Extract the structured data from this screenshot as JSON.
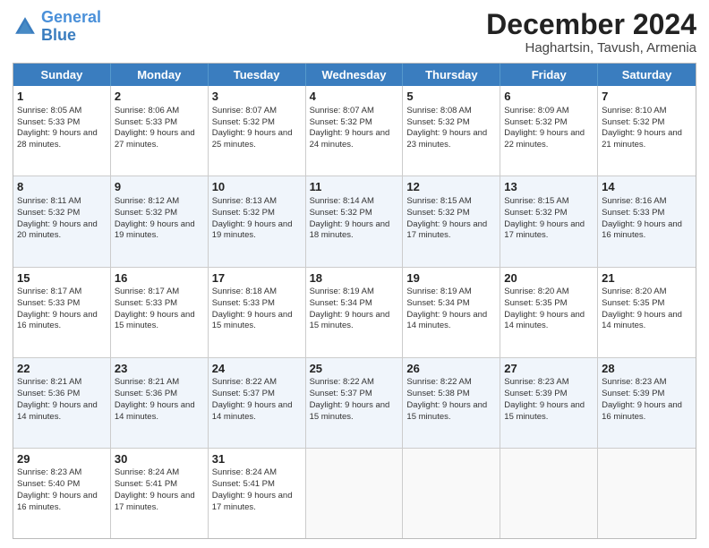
{
  "header": {
    "logo_line1": "General",
    "logo_line2": "Blue",
    "title": "December 2024",
    "subtitle": "Haghartsin, Tavush, Armenia"
  },
  "days": [
    "Sunday",
    "Monday",
    "Tuesday",
    "Wednesday",
    "Thursday",
    "Friday",
    "Saturday"
  ],
  "weeks": [
    [
      {
        "num": "1",
        "sunrise": "Sunrise: 8:05 AM",
        "sunset": "Sunset: 5:33 PM",
        "daylight": "Daylight: 9 hours and 28 minutes."
      },
      {
        "num": "2",
        "sunrise": "Sunrise: 8:06 AM",
        "sunset": "Sunset: 5:33 PM",
        "daylight": "Daylight: 9 hours and 27 minutes."
      },
      {
        "num": "3",
        "sunrise": "Sunrise: 8:07 AM",
        "sunset": "Sunset: 5:32 PM",
        "daylight": "Daylight: 9 hours and 25 minutes."
      },
      {
        "num": "4",
        "sunrise": "Sunrise: 8:07 AM",
        "sunset": "Sunset: 5:32 PM",
        "daylight": "Daylight: 9 hours and 24 minutes."
      },
      {
        "num": "5",
        "sunrise": "Sunrise: 8:08 AM",
        "sunset": "Sunset: 5:32 PM",
        "daylight": "Daylight: 9 hours and 23 minutes."
      },
      {
        "num": "6",
        "sunrise": "Sunrise: 8:09 AM",
        "sunset": "Sunset: 5:32 PM",
        "daylight": "Daylight: 9 hours and 22 minutes."
      },
      {
        "num": "7",
        "sunrise": "Sunrise: 8:10 AM",
        "sunset": "Sunset: 5:32 PM",
        "daylight": "Daylight: 9 hours and 21 minutes."
      }
    ],
    [
      {
        "num": "8",
        "sunrise": "Sunrise: 8:11 AM",
        "sunset": "Sunset: 5:32 PM",
        "daylight": "Daylight: 9 hours and 20 minutes."
      },
      {
        "num": "9",
        "sunrise": "Sunrise: 8:12 AM",
        "sunset": "Sunset: 5:32 PM",
        "daylight": "Daylight: 9 hours and 19 minutes."
      },
      {
        "num": "10",
        "sunrise": "Sunrise: 8:13 AM",
        "sunset": "Sunset: 5:32 PM",
        "daylight": "Daylight: 9 hours and 19 minutes."
      },
      {
        "num": "11",
        "sunrise": "Sunrise: 8:14 AM",
        "sunset": "Sunset: 5:32 PM",
        "daylight": "Daylight: 9 hours and 18 minutes."
      },
      {
        "num": "12",
        "sunrise": "Sunrise: 8:15 AM",
        "sunset": "Sunset: 5:32 PM",
        "daylight": "Daylight: 9 hours and 17 minutes."
      },
      {
        "num": "13",
        "sunrise": "Sunrise: 8:15 AM",
        "sunset": "Sunset: 5:32 PM",
        "daylight": "Daylight: 9 hours and 17 minutes."
      },
      {
        "num": "14",
        "sunrise": "Sunrise: 8:16 AM",
        "sunset": "Sunset: 5:33 PM",
        "daylight": "Daylight: 9 hours and 16 minutes."
      }
    ],
    [
      {
        "num": "15",
        "sunrise": "Sunrise: 8:17 AM",
        "sunset": "Sunset: 5:33 PM",
        "daylight": "Daylight: 9 hours and 16 minutes."
      },
      {
        "num": "16",
        "sunrise": "Sunrise: 8:17 AM",
        "sunset": "Sunset: 5:33 PM",
        "daylight": "Daylight: 9 hours and 15 minutes."
      },
      {
        "num": "17",
        "sunrise": "Sunrise: 8:18 AM",
        "sunset": "Sunset: 5:33 PM",
        "daylight": "Daylight: 9 hours and 15 minutes."
      },
      {
        "num": "18",
        "sunrise": "Sunrise: 8:19 AM",
        "sunset": "Sunset: 5:34 PM",
        "daylight": "Daylight: 9 hours and 15 minutes."
      },
      {
        "num": "19",
        "sunrise": "Sunrise: 8:19 AM",
        "sunset": "Sunset: 5:34 PM",
        "daylight": "Daylight: 9 hours and 14 minutes."
      },
      {
        "num": "20",
        "sunrise": "Sunrise: 8:20 AM",
        "sunset": "Sunset: 5:35 PM",
        "daylight": "Daylight: 9 hours and 14 minutes."
      },
      {
        "num": "21",
        "sunrise": "Sunrise: 8:20 AM",
        "sunset": "Sunset: 5:35 PM",
        "daylight": "Daylight: 9 hours and 14 minutes."
      }
    ],
    [
      {
        "num": "22",
        "sunrise": "Sunrise: 8:21 AM",
        "sunset": "Sunset: 5:36 PM",
        "daylight": "Daylight: 9 hours and 14 minutes."
      },
      {
        "num": "23",
        "sunrise": "Sunrise: 8:21 AM",
        "sunset": "Sunset: 5:36 PM",
        "daylight": "Daylight: 9 hours and 14 minutes."
      },
      {
        "num": "24",
        "sunrise": "Sunrise: 8:22 AM",
        "sunset": "Sunset: 5:37 PM",
        "daylight": "Daylight: 9 hours and 14 minutes."
      },
      {
        "num": "25",
        "sunrise": "Sunrise: 8:22 AM",
        "sunset": "Sunset: 5:37 PM",
        "daylight": "Daylight: 9 hours and 15 minutes."
      },
      {
        "num": "26",
        "sunrise": "Sunrise: 8:22 AM",
        "sunset": "Sunset: 5:38 PM",
        "daylight": "Daylight: 9 hours and 15 minutes."
      },
      {
        "num": "27",
        "sunrise": "Sunrise: 8:23 AM",
        "sunset": "Sunset: 5:39 PM",
        "daylight": "Daylight: 9 hours and 15 minutes."
      },
      {
        "num": "28",
        "sunrise": "Sunrise: 8:23 AM",
        "sunset": "Sunset: 5:39 PM",
        "daylight": "Daylight: 9 hours and 16 minutes."
      }
    ],
    [
      {
        "num": "29",
        "sunrise": "Sunrise: 8:23 AM",
        "sunset": "Sunset: 5:40 PM",
        "daylight": "Daylight: 9 hours and 16 minutes."
      },
      {
        "num": "30",
        "sunrise": "Sunrise: 8:24 AM",
        "sunset": "Sunset: 5:41 PM",
        "daylight": "Daylight: 9 hours and 17 minutes."
      },
      {
        "num": "31",
        "sunrise": "Sunrise: 8:24 AM",
        "sunset": "Sunset: 5:41 PM",
        "daylight": "Daylight: 9 hours and 17 minutes."
      },
      null,
      null,
      null,
      null
    ]
  ]
}
